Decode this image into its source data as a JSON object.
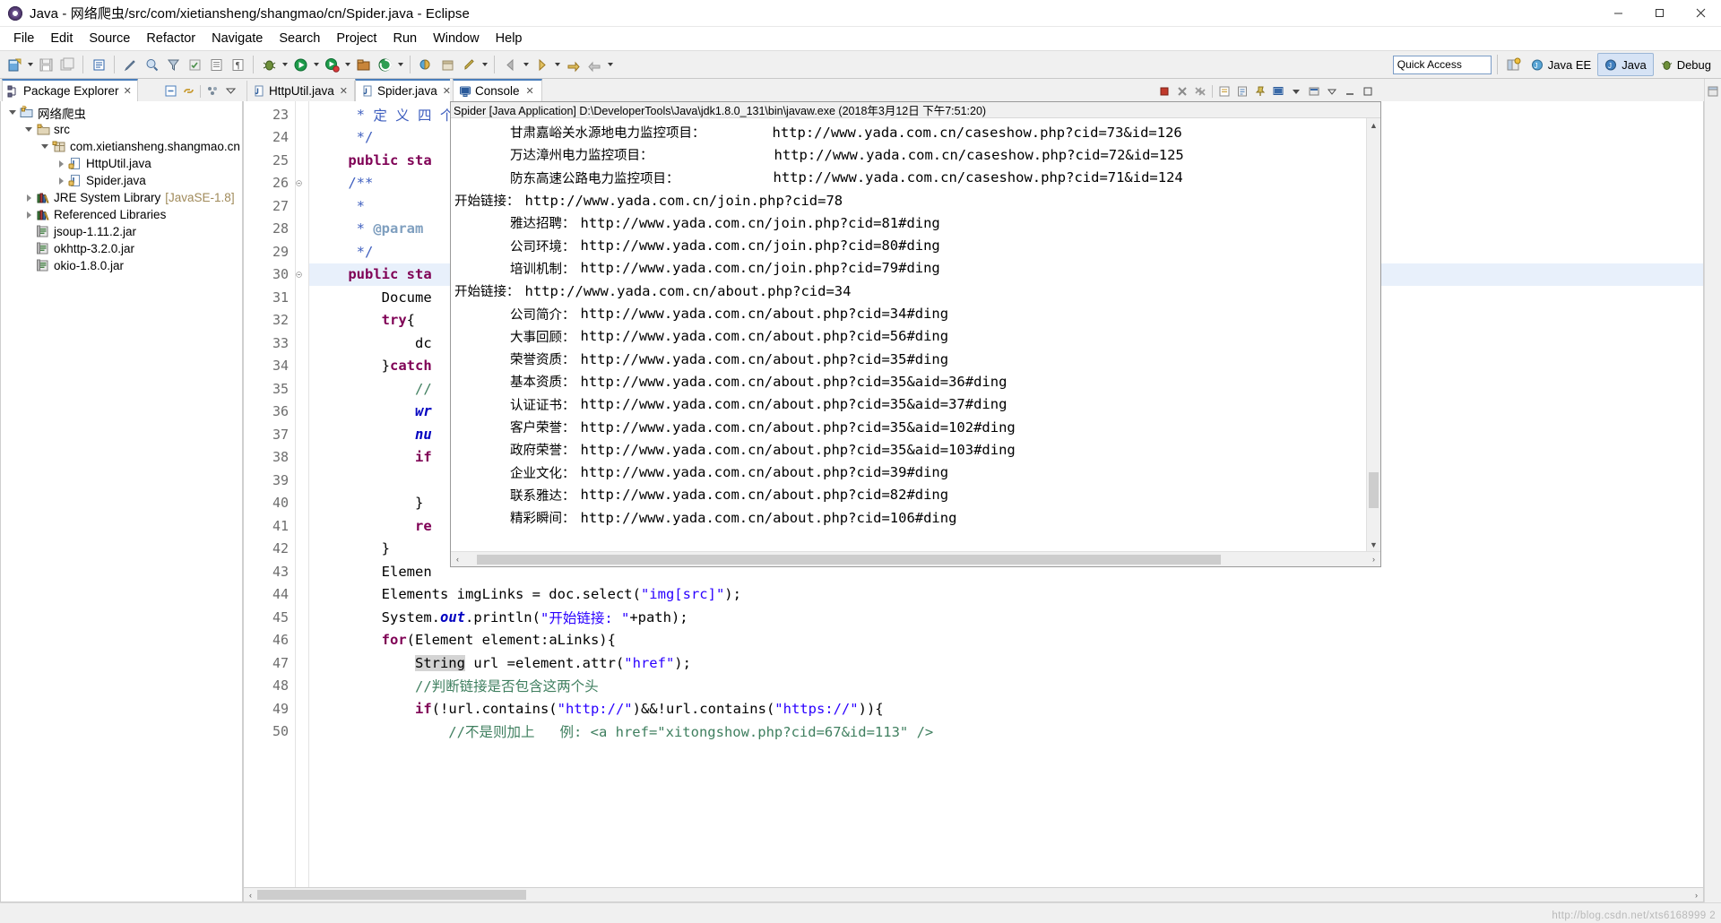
{
  "window": {
    "title": "Java - 网络爬虫/src/com/xietiansheng/shangmao/cn/Spider.java - Eclipse",
    "minimize_label": "—",
    "maximize_label": "▢",
    "close_label": "✕"
  },
  "menu": {
    "items": [
      {
        "label": "File"
      },
      {
        "label": "Edit"
      },
      {
        "label": "Source"
      },
      {
        "label": "Refactor"
      },
      {
        "label": "Navigate"
      },
      {
        "label": "Search"
      },
      {
        "label": "Project"
      },
      {
        "label": "Run"
      },
      {
        "label": "Window"
      },
      {
        "label": "Help"
      }
    ]
  },
  "toolbar": {
    "quick_access_value": "Quick Access",
    "quick_access_placeholder": "Quick Access",
    "perspectives": [
      {
        "label": "Java EE",
        "active": false
      },
      {
        "label": "Java",
        "active": true
      },
      {
        "label": "Debug",
        "active": false
      }
    ]
  },
  "explorer": {
    "tab_label": "Package Explorer",
    "close_label": "✕",
    "tree": [
      {
        "label": "网络爬虫",
        "indent": 0,
        "twisty": "open",
        "icon": "project-icon",
        "suffix": ""
      },
      {
        "label": "src",
        "indent": 1,
        "twisty": "open",
        "icon": "source-folder-icon",
        "suffix": ""
      },
      {
        "label": "com.xietiansheng.shangmao.cn",
        "indent": 2,
        "twisty": "open",
        "icon": "package-icon",
        "suffix": ""
      },
      {
        "label": "HttpUtil.java",
        "indent": 3,
        "twisty": "closed",
        "icon": "java-file-icon",
        "suffix": ""
      },
      {
        "label": "Spider.java",
        "indent": 3,
        "twisty": "closed",
        "icon": "java-file-icon",
        "suffix": ""
      },
      {
        "label": "JRE System Library",
        "indent": 1,
        "twisty": "closed",
        "icon": "library-icon",
        "suffix": "[JavaSE-1.8]"
      },
      {
        "label": "Referenced Libraries",
        "indent": 1,
        "twisty": "closed",
        "icon": "library-icon",
        "suffix": ""
      },
      {
        "label": "jsoup-1.11.2.jar",
        "indent": 1,
        "twisty": "none",
        "icon": "jar-icon",
        "suffix": ""
      },
      {
        "label": "okhttp-3.2.0.jar",
        "indent": 1,
        "twisty": "none",
        "icon": "jar-icon",
        "suffix": ""
      },
      {
        "label": "okio-1.8.0.jar",
        "indent": 1,
        "twisty": "none",
        "icon": "jar-icon",
        "suffix": ""
      }
    ]
  },
  "editor": {
    "tabs": [
      {
        "label": "HttpUtil.java",
        "active": false,
        "close_label": "✕"
      },
      {
        "label": "Spider.java",
        "active": true,
        "close_label": "✕"
      }
    ],
    "lines": [
      {
        "num": "23",
        "highlight": false,
        "marker": "none",
        "segments": [
          {
            "t": "     * ",
            "c": "jdoc"
          },
          {
            "t": "定 义 四 个",
            "c": "jdoc"
          }
        ]
      },
      {
        "num": "24",
        "highlight": false,
        "marker": "none",
        "segments": [
          {
            "t": "     */",
            "c": "jdoc"
          }
        ]
      },
      {
        "num": "25",
        "highlight": false,
        "marker": "none",
        "segments": [
          {
            "t": "    ",
            "c": ""
          },
          {
            "t": "public",
            "c": "kw"
          },
          {
            "t": " ",
            "c": ""
          },
          {
            "t": "sta",
            "c": "kw"
          }
        ]
      },
      {
        "num": "26",
        "highlight": false,
        "marker": "fold",
        "segments": [
          {
            "t": "    /**",
            "c": "jdoc"
          }
        ]
      },
      {
        "num": "27",
        "highlight": false,
        "marker": "none",
        "segments": [
          {
            "t": "     *",
            "c": "jdoc"
          }
        ]
      },
      {
        "num": "28",
        "highlight": false,
        "marker": "none",
        "segments": [
          {
            "t": "     * ",
            "c": "jdoc"
          },
          {
            "t": "@param",
            "c": "jdoc-tag"
          }
        ]
      },
      {
        "num": "29",
        "highlight": false,
        "marker": "none",
        "segments": [
          {
            "t": "     */",
            "c": "jdoc"
          }
        ]
      },
      {
        "num": "30",
        "highlight": true,
        "marker": "fold",
        "segments": [
          {
            "t": "    ",
            "c": ""
          },
          {
            "t": "public",
            "c": "kw"
          },
          {
            "t": " ",
            "c": ""
          },
          {
            "t": "sta",
            "c": "kw"
          }
        ]
      },
      {
        "num": "31",
        "highlight": false,
        "marker": "none",
        "segments": [
          {
            "t": "        Docume",
            "c": ""
          }
        ]
      },
      {
        "num": "32",
        "highlight": false,
        "marker": "none",
        "segments": [
          {
            "t": "        ",
            "c": ""
          },
          {
            "t": "try",
            "c": "kw"
          },
          {
            "t": "{",
            "c": ""
          }
        ]
      },
      {
        "num": "33",
        "highlight": false,
        "marker": "none",
        "segments": [
          {
            "t": "            dc",
            "c": ""
          }
        ]
      },
      {
        "num": "34",
        "highlight": false,
        "marker": "none",
        "segments": [
          {
            "t": "        }",
            "c": ""
          },
          {
            "t": "catch",
            "c": "kw"
          }
        ]
      },
      {
        "num": "35",
        "highlight": false,
        "marker": "none",
        "segments": [
          {
            "t": "            //",
            "c": "cmt"
          }
        ]
      },
      {
        "num": "36",
        "highlight": false,
        "marker": "none",
        "segments": [
          {
            "t": "            ",
            "c": ""
          },
          {
            "t": "wr",
            "c": "fld"
          }
        ]
      },
      {
        "num": "37",
        "highlight": false,
        "marker": "none",
        "segments": [
          {
            "t": "            ",
            "c": ""
          },
          {
            "t": "nu",
            "c": "fld"
          }
        ]
      },
      {
        "num": "38",
        "highlight": false,
        "marker": "none",
        "segments": [
          {
            "t": "            ",
            "c": ""
          },
          {
            "t": "if",
            "c": "kw"
          }
        ]
      },
      {
        "num": "39",
        "highlight": false,
        "marker": "none",
        "segments": [
          {
            "t": "",
            "c": ""
          }
        ]
      },
      {
        "num": "40",
        "highlight": false,
        "marker": "none",
        "segments": [
          {
            "t": "            }",
            "c": ""
          }
        ]
      },
      {
        "num": "41",
        "highlight": false,
        "marker": "none",
        "segments": [
          {
            "t": "            ",
            "c": ""
          },
          {
            "t": "re",
            "c": "kw"
          }
        ]
      },
      {
        "num": "42",
        "highlight": false,
        "marker": "none",
        "segments": [
          {
            "t": "        }",
            "c": ""
          }
        ]
      },
      {
        "num": "43",
        "highlight": false,
        "marker": "none",
        "segments": [
          {
            "t": "        Elemen",
            "c": ""
          }
        ]
      },
      {
        "num": "44",
        "highlight": false,
        "marker": "none",
        "segments": [
          {
            "t": "        Elements imgLinks = doc.select(",
            "c": ""
          },
          {
            "t": "\"img[src]\"",
            "c": "str"
          },
          {
            "t": ");",
            "c": ""
          }
        ]
      },
      {
        "num": "45",
        "highlight": false,
        "marker": "none",
        "segments": [
          {
            "t": "        System.",
            "c": ""
          },
          {
            "t": "out",
            "c": "fld"
          },
          {
            "t": ".println(",
            "c": ""
          },
          {
            "t": "\"开始链接: \"",
            "c": "str"
          },
          {
            "t": "+path);",
            "c": ""
          }
        ]
      },
      {
        "num": "46",
        "highlight": false,
        "marker": "none",
        "segments": [
          {
            "t": "        ",
            "c": ""
          },
          {
            "t": "for",
            "c": "kw"
          },
          {
            "t": "(Element ",
            "c": ""
          },
          {
            "t": "element",
            "c": "param"
          },
          {
            "t": ":aLinks){",
            "c": ""
          }
        ]
      },
      {
        "num": "47",
        "highlight": false,
        "marker": "none",
        "segments": [
          {
            "t": "            ",
            "c": ""
          },
          {
            "t": "String",
            "c": "sel"
          },
          {
            "t": " url =element.attr(",
            "c": ""
          },
          {
            "t": "\"href\"",
            "c": "str"
          },
          {
            "t": ");",
            "c": ""
          }
        ]
      },
      {
        "num": "48",
        "highlight": false,
        "marker": "none",
        "segments": [
          {
            "t": "            //判断链接是否包含这两个头",
            "c": "cmt"
          }
        ]
      },
      {
        "num": "49",
        "highlight": false,
        "marker": "none",
        "segments": [
          {
            "t": "            ",
            "c": ""
          },
          {
            "t": "if",
            "c": "kw"
          },
          {
            "t": "(!url.contains(",
            "c": ""
          },
          {
            "t": "\"http://\"",
            "c": "str"
          },
          {
            "t": ")&&!url.contains(",
            "c": ""
          },
          {
            "t": "\"https://\"",
            "c": "str"
          },
          {
            "t": ")){",
            "c": ""
          }
        ]
      },
      {
        "num": "50",
        "highlight": false,
        "marker": "none",
        "segments": [
          {
            "t": "                //不是则加上   例: <a href=\"xitongshow.php?cid=67&id=113\" />",
            "c": "cmt"
          }
        ]
      }
    ]
  },
  "console": {
    "tab_label": "Console",
    "close_label": "✕",
    "process_header": "Spider [Java Application] D:\\DeveloperTools\\Java\\jdk1.8.0_131\\bin\\javaw.exe (2018年3月12日 下午7:51:20)",
    "output_lines": [
      {
        "indent": 1,
        "label": "甘肃嘉峪关水源地电力监控项目：",
        "url": "http://www.yada.com.cn/caseshow.php?cid=73&id=126"
      },
      {
        "indent": 1,
        "label": "万达漳州电力监控项目：",
        "url": "http://www.yada.com.cn/caseshow.php?cid=72&id=125"
      },
      {
        "indent": 1,
        "label": "防东高速公路电力监控项目：",
        "url": "http://www.yada.com.cn/caseshow.php?cid=71&id=124"
      },
      {
        "indent": 0,
        "label": "开始链接：",
        "url": "http://www.yada.com.cn/join.php?cid=78"
      },
      {
        "indent": 1,
        "label": "雅达招聘：",
        "url": "http://www.yada.com.cn/join.php?cid=81#ding"
      },
      {
        "indent": 1,
        "label": "公司环境：",
        "url": "http://www.yada.com.cn/join.php?cid=80#ding"
      },
      {
        "indent": 1,
        "label": "培训机制：",
        "url": "http://www.yada.com.cn/join.php?cid=79#ding"
      },
      {
        "indent": 0,
        "label": "开始链接：",
        "url": "http://www.yada.com.cn/about.php?cid=34"
      },
      {
        "indent": 1,
        "label": "公司简介：",
        "url": "http://www.yada.com.cn/about.php?cid=34#ding"
      },
      {
        "indent": 1,
        "label": "大事回顾：",
        "url": "http://www.yada.com.cn/about.php?cid=56#ding"
      },
      {
        "indent": 1,
        "label": "荣誉资质：",
        "url": "http://www.yada.com.cn/about.php?cid=35#ding"
      },
      {
        "indent": 1,
        "label": "基本资质：",
        "url": "http://www.yada.com.cn/about.php?cid=35&aid=36#ding"
      },
      {
        "indent": 1,
        "label": "认证证书：",
        "url": "http://www.yada.com.cn/about.php?cid=35&aid=37#ding"
      },
      {
        "indent": 1,
        "label": "客户荣誉：",
        "url": "http://www.yada.com.cn/about.php?cid=35&aid=102#ding"
      },
      {
        "indent": 1,
        "label": "政府荣誉：",
        "url": "http://www.yada.com.cn/about.php?cid=35&aid=103#ding"
      },
      {
        "indent": 1,
        "label": "企业文化：",
        "url": "http://www.yada.com.cn/about.php?cid=39#ding"
      },
      {
        "indent": 1,
        "label": "联系雅达：",
        "url": "http://www.yada.com.cn/about.php?cid=82#ding"
      },
      {
        "indent": 1,
        "label": "精彩瞬间：",
        "url": "http://www.yada.com.cn/about.php?cid=106#ding"
      }
    ]
  },
  "status": {
    "watermark": "http://blog.csdn.net/xts6168999 2"
  },
  "colors": {
    "accent": "#4a7ebb",
    "keyword": "#7f0055",
    "string": "#2a00ff",
    "comment": "#3f7f5f",
    "javadoc": "#3f5fbf",
    "selection": "#e8f0fb"
  }
}
